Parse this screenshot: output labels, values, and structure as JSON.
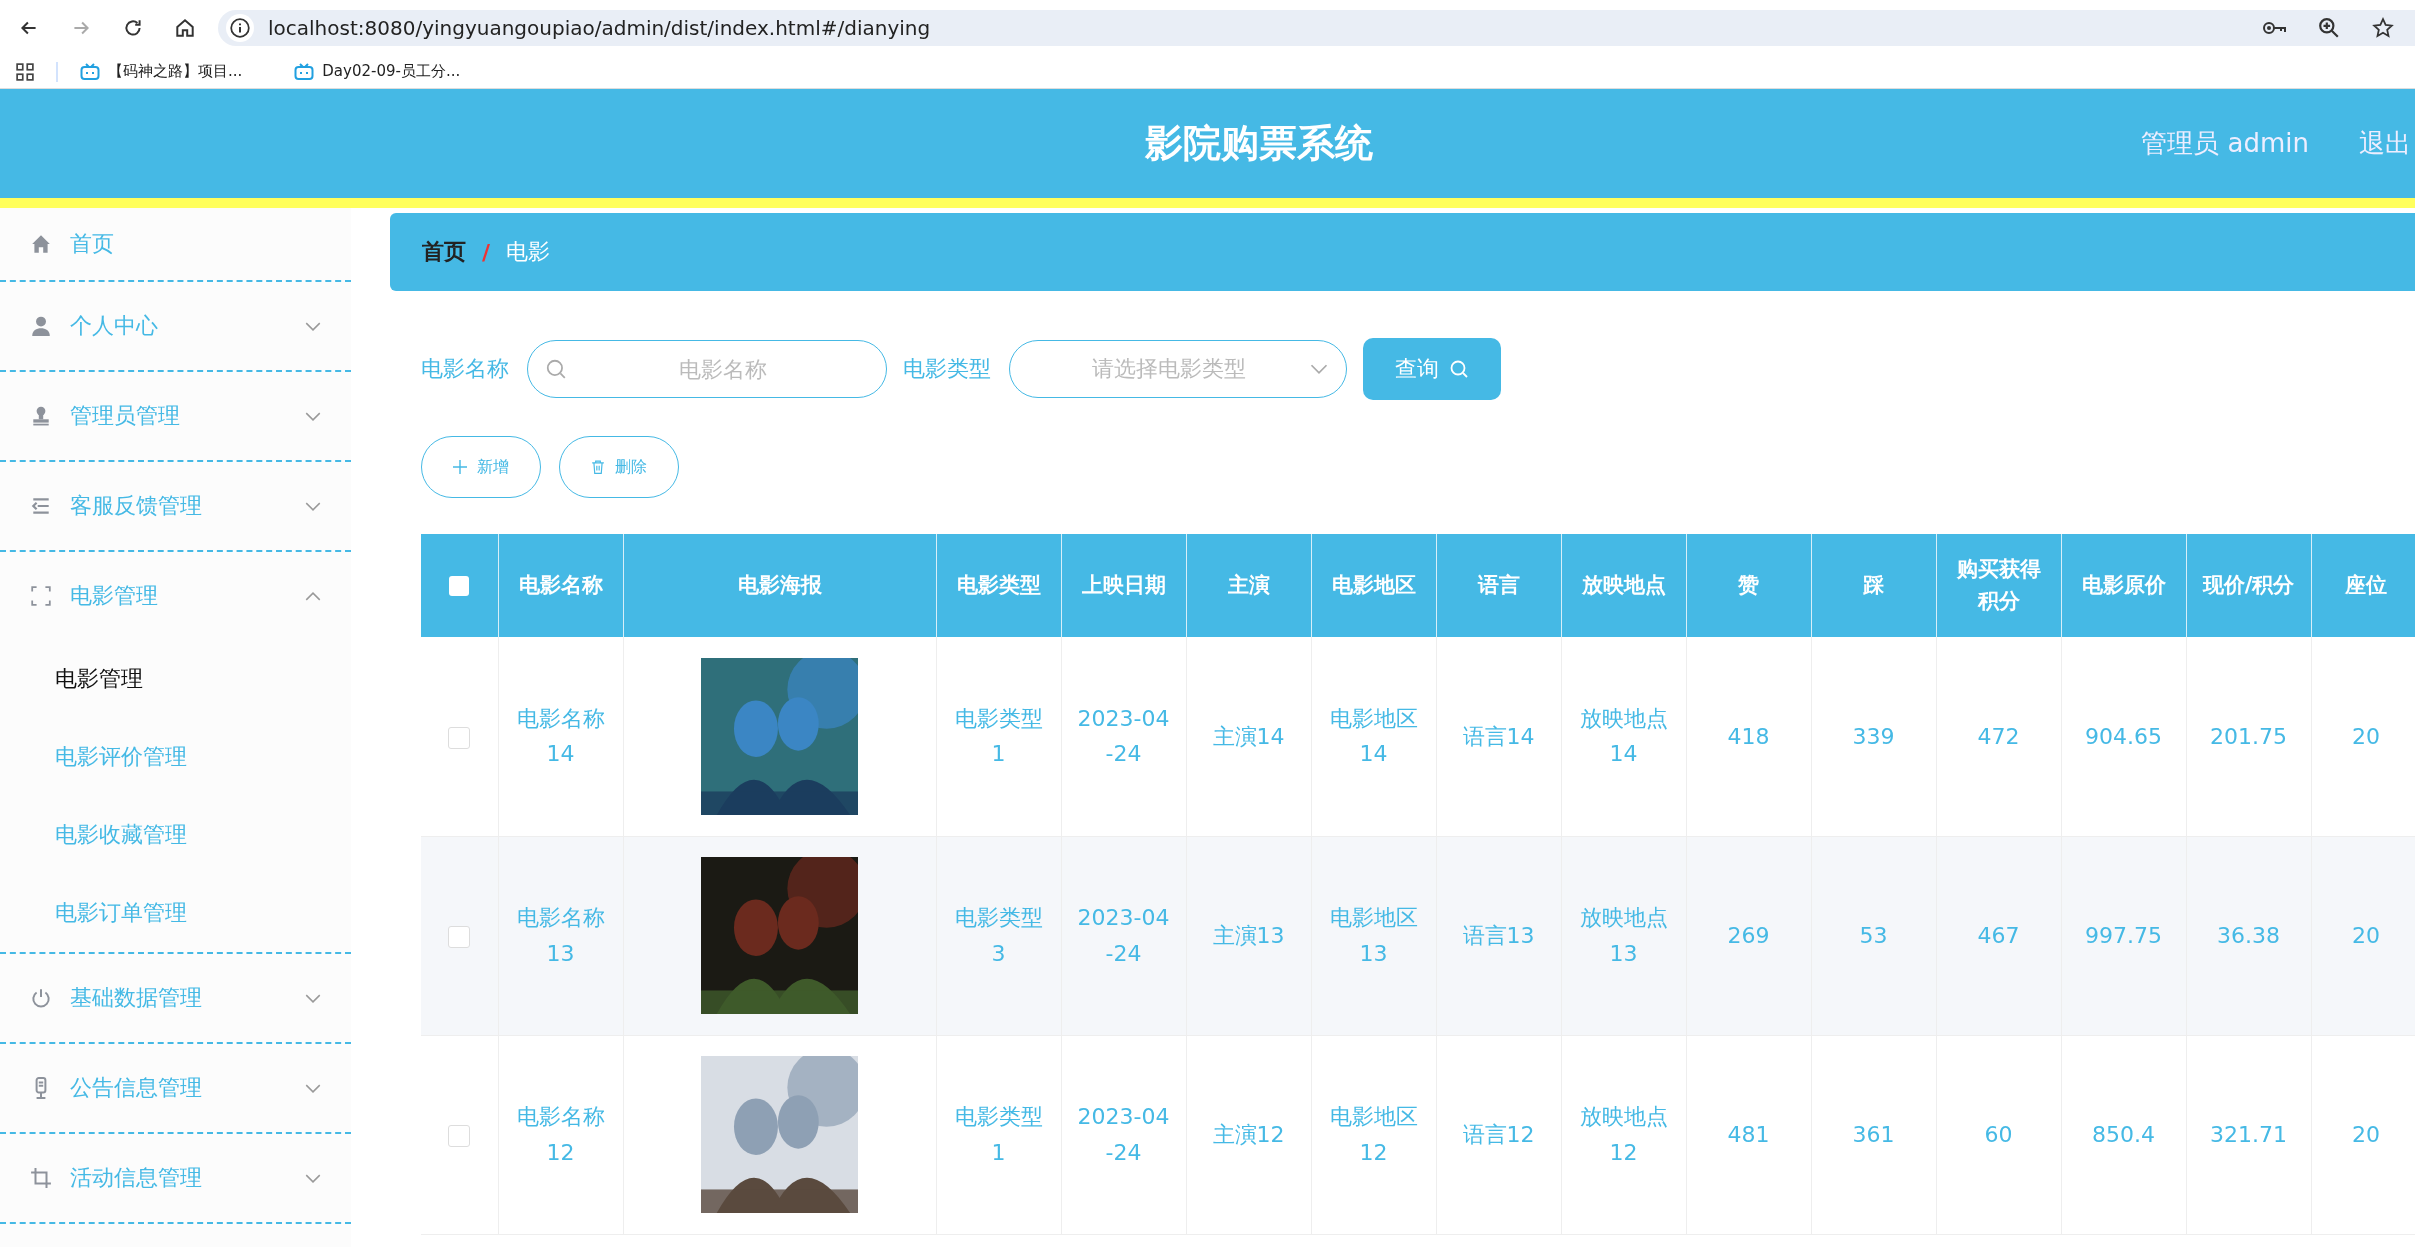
{
  "browser": {
    "url": "localhost:8080/yingyuangoupiao/admin/dist/index.html#/dianying",
    "bookmarks": [
      "【码神之路】项目...",
      "Day02-09-员工分..."
    ]
  },
  "header": {
    "title": "影院购票系统",
    "user": "管理员 admin",
    "logout": "退出"
  },
  "sidebar": {
    "items": [
      {
        "label": "首页"
      },
      {
        "label": "个人中心",
        "expanded": false
      },
      {
        "label": "管理员管理",
        "expanded": false
      },
      {
        "label": "客服反馈管理",
        "expanded": false
      },
      {
        "label": "电影管理",
        "expanded": true,
        "children": [
          {
            "label": "电影管理",
            "selected": true
          },
          {
            "label": "电影评价管理",
            "selected": false
          },
          {
            "label": "电影收藏管理",
            "selected": false
          },
          {
            "label": "电影订单管理",
            "selected": false
          }
        ]
      },
      {
        "label": "基础数据管理",
        "expanded": false
      },
      {
        "label": "公告信息管理",
        "expanded": false
      },
      {
        "label": "活动信息管理",
        "expanded": false
      }
    ]
  },
  "breadcrumb": {
    "items": [
      "首页",
      "电影"
    ],
    "separator": "/"
  },
  "search": {
    "name_label": "电影名称",
    "name_placeholder": "电影名称",
    "type_label": "电影类型",
    "type_placeholder": "请选择电影类型",
    "query_button": "查询"
  },
  "actions": {
    "add": "新增",
    "delete": "删除"
  },
  "table": {
    "all_checked": false,
    "columns": [
      "电影名称",
      "电影海报",
      "电影类型",
      "上映日期",
      "主演",
      "电影地区",
      "语言",
      "放映地点",
      "赞",
      "踩",
      "购买获得积分",
      "电影原价",
      "现价/积分",
      "座位"
    ],
    "rows": [
      {
        "checked": false,
        "cells": [
          "电影名称14",
          null,
          "电影类型1",
          "2023-04-24",
          "主演14",
          "电影地区14",
          "语言14",
          "放映地点14",
          "418",
          "339",
          "472",
          "904.65",
          "201.75",
          "20"
        ]
      },
      {
        "checked": false,
        "cells": [
          "电影名称13",
          null,
          "电影类型3",
          "2023-04-24",
          "主演13",
          "电影地区13",
          "语言13",
          "放映地点13",
          "269",
          "53",
          "467",
          "997.75",
          "36.38",
          "20"
        ]
      },
      {
        "checked": false,
        "cells": [
          "电影名称12",
          null,
          "电影类型1",
          "2023-04-24",
          "主演12",
          "电影地区12",
          "语言12",
          "放映地点12",
          "481",
          "361",
          "60",
          "850.4",
          "321.71",
          "20"
        ]
      }
    ]
  }
}
